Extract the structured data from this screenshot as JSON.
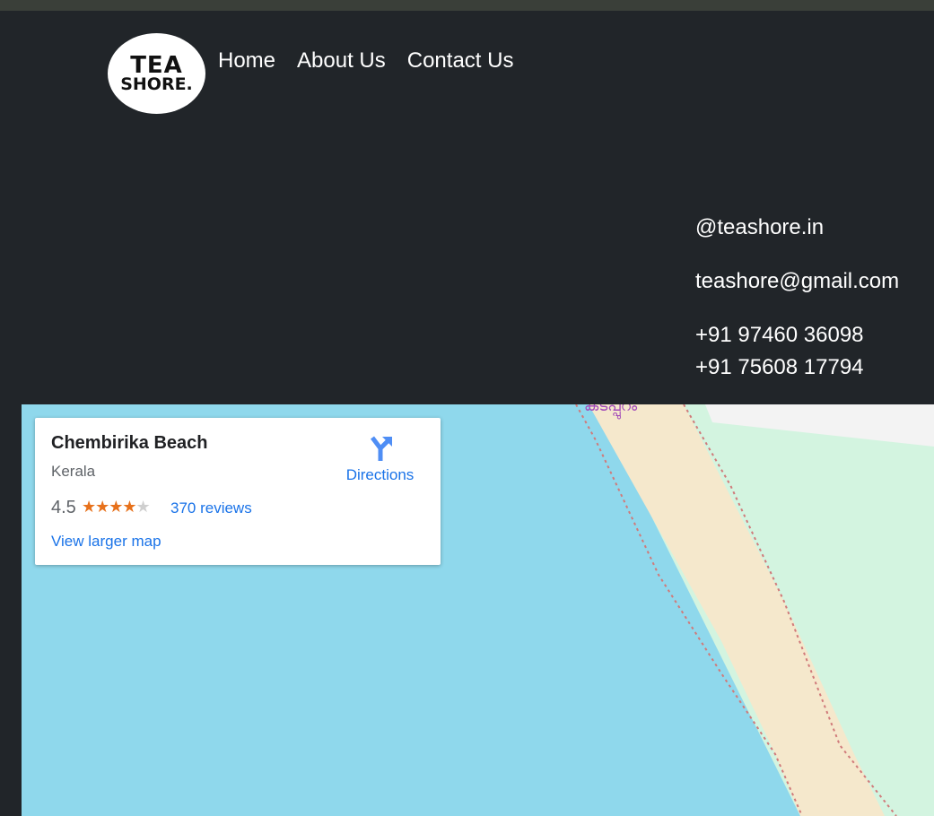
{
  "logo": {
    "line1": "TEA",
    "line2": "SHORE."
  },
  "nav": {
    "home": "Home",
    "about": "About Us",
    "contact": "Contact Us"
  },
  "contact": {
    "instagram": "@teashore.in",
    "email": "teashore@gmail.com",
    "phone1": "+91 97460 36098",
    "phone2": "+91 75608 17794"
  },
  "map": {
    "place_label": "കടപ്പുറം",
    "colors": {
      "water": "#8fd8ec",
      "sand": "#f5e8cc",
      "land": "#d3f4e0",
      "building": "#f3f3f3",
      "boundary": "#d07a7a"
    }
  },
  "place_card": {
    "name": "Chembirika Beach",
    "region": "Kerala",
    "rating": "4.5",
    "stars": 4.5,
    "reviews": "370 reviews",
    "directions": "Directions",
    "view_larger": "View larger map",
    "icon": "directions-icon"
  }
}
